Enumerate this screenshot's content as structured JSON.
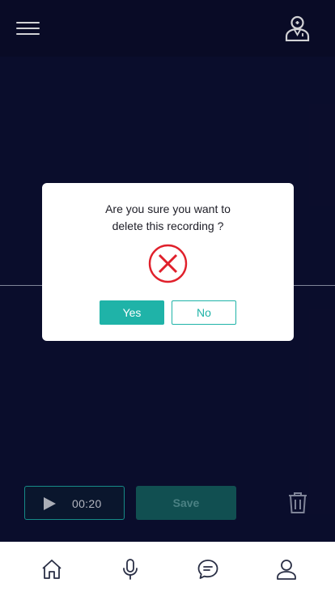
{
  "header": {
    "menu_icon": "hamburger-menu-icon",
    "doctor_icon": "doctor-profile-icon"
  },
  "player": {
    "play_icon": "play-icon",
    "time": "00:20"
  },
  "actions": {
    "save_label": "Save",
    "delete_icon": "trash-icon"
  },
  "dialog": {
    "message_line1": "Are you sure you want to",
    "message_line2": "delete this recording ?",
    "icon": "error-x-icon",
    "yes_label": "Yes",
    "no_label": "No"
  },
  "bottom_nav": {
    "items": [
      {
        "icon": "home-icon"
      },
      {
        "icon": "microphone-icon"
      },
      {
        "icon": "chat-icon"
      },
      {
        "icon": "user-icon"
      }
    ]
  },
  "colors": {
    "background": "#0c0f31",
    "accent": "#1fb3a8",
    "danger": "#e0202b"
  }
}
